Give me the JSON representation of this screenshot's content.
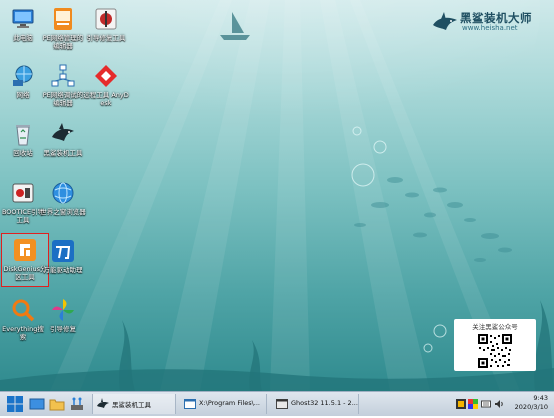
{
  "desktop": {
    "icons": [
      {
        "label": "此电脑",
        "icon": "computer-icon"
      },
      {
        "label": "PE网络管理的编辑器",
        "icon": "pe-network-editor-icon"
      },
      {
        "label": "引导修复工具",
        "icon": "boot-repair-icon"
      },
      {
        "label": "网络",
        "icon": "network-icon"
      },
      {
        "label": "PE网络调试的编辑器",
        "icon": "network-topology-icon"
      },
      {
        "label": "远程工具 AnyDesk",
        "icon": "anydesk-icon"
      },
      {
        "label": "回收站",
        "icon": "recycle-bin-icon"
      },
      {
        "label": "黑鲨装机工具",
        "icon": "heisha-installer-icon"
      },
      {
        "label": "BOOTICE引导工具",
        "icon": "bootice-icon"
      },
      {
        "label": "世界之窗浏览器",
        "icon": "theworld-browser-icon"
      },
      {
        "label": "DiskGenius分区工具",
        "icon": "diskgenius-icon"
      },
      {
        "label": "万能驱动助理",
        "icon": "wan-driver-icon"
      },
      {
        "label": "Everything搜索",
        "icon": "everything-search-icon"
      },
      {
        "label": "引导修复",
        "icon": "pinwheel-icon"
      }
    ],
    "selected": "DiskGenius分区工具"
  },
  "brand": {
    "name": "黑鲨装机大师",
    "url": "www.heisha.net"
  },
  "qr_card": {
    "title": "关注黑鲨公众号"
  },
  "taskbar": {
    "tasks": [
      {
        "label": "黑鲨装机工具",
        "icon": "heisha-installer-icon"
      },
      {
        "label": "X:\\Program Files\\...",
        "icon": "folder-window-icon"
      },
      {
        "label": "Ghost32 11.5.1 - 2...",
        "icon": "ghost-icon"
      }
    ],
    "clock": {
      "time": "9:43",
      "date": "2020/3/10"
    }
  },
  "colors": {
    "selection_border": "#e02020",
    "brand_text": "#1f4f62"
  }
}
